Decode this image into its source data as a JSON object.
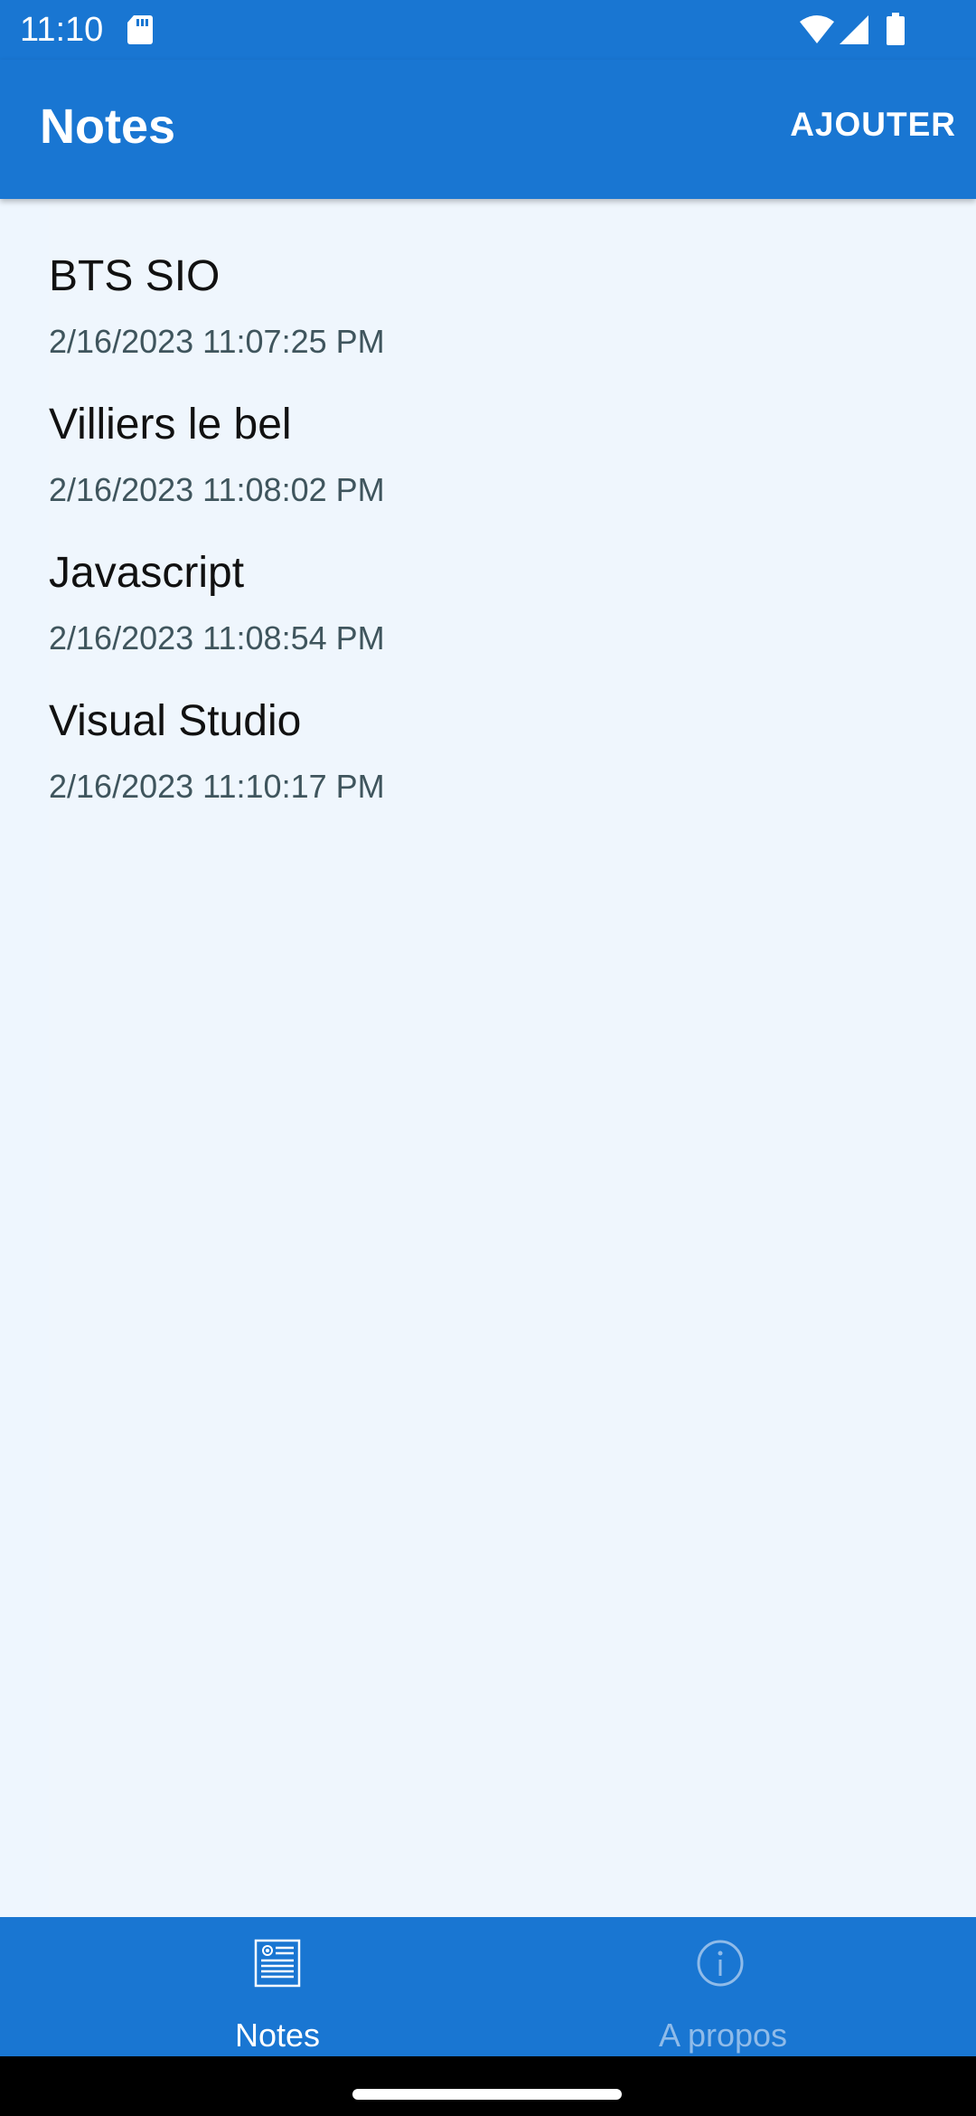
{
  "status_bar": {
    "time": "11:10"
  },
  "app_bar": {
    "title": "Notes",
    "add_label": "AJOUTER"
  },
  "notes": [
    {
      "title": "BTS SIO",
      "date": "2/16/2023 11:07:25 PM"
    },
    {
      "title": "Villiers le bel",
      "date": "2/16/2023 11:08:02 PM"
    },
    {
      "title": "Javascript",
      "date": "2/16/2023 11:08:54 PM"
    },
    {
      "title": "Visual Studio",
      "date": "2/16/2023 11:10:17 PM"
    }
  ],
  "tabs": [
    {
      "label": "Notes",
      "icon": "notes-icon",
      "selected": true
    },
    {
      "label": "A propos",
      "icon": "info-icon",
      "selected": false
    }
  ],
  "colors": {
    "primary": "#1976d2",
    "background": "#eef6fe",
    "date_text": "#3f555d",
    "tab_inactive": "#8fbbe9"
  }
}
